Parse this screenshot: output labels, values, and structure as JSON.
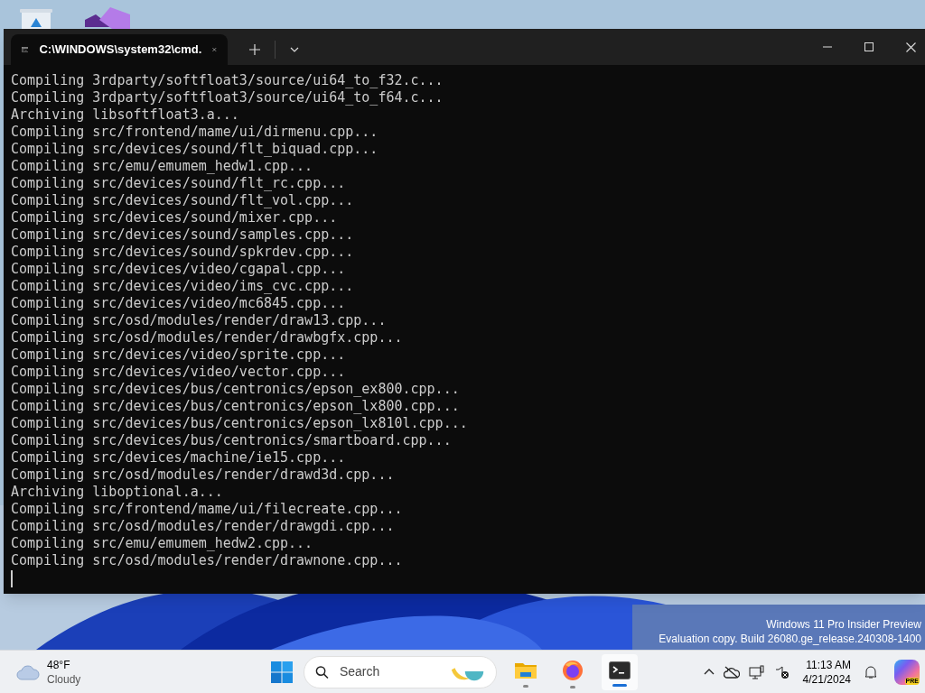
{
  "terminal": {
    "tab_title": "C:\\WINDOWS\\system32\\cmd.",
    "tab_selected": true,
    "lines": [
      "Compiling 3rdparty/softfloat3/source/ui64_to_f32.c...",
      "Compiling 3rdparty/softfloat3/source/ui64_to_f64.c...",
      "Archiving libsoftfloat3.a...",
      "Compiling src/frontend/mame/ui/dirmenu.cpp...",
      "Compiling src/devices/sound/flt_biquad.cpp...",
      "Compiling src/emu/emumem_hedw1.cpp...",
      "Compiling src/devices/sound/flt_rc.cpp...",
      "Compiling src/devices/sound/flt_vol.cpp...",
      "Compiling src/devices/sound/mixer.cpp...",
      "Compiling src/devices/sound/samples.cpp...",
      "Compiling src/devices/sound/spkrdev.cpp...",
      "Compiling src/devices/video/cgapal.cpp...",
      "Compiling src/devices/video/ims_cvc.cpp...",
      "Compiling src/devices/video/mc6845.cpp...",
      "Compiling src/osd/modules/render/draw13.cpp...",
      "Compiling src/osd/modules/render/drawbgfx.cpp...",
      "Compiling src/devices/video/sprite.cpp...",
      "Compiling src/devices/video/vector.cpp...",
      "Compiling src/devices/bus/centronics/epson_ex800.cpp...",
      "Compiling src/devices/bus/centronics/epson_lx800.cpp...",
      "Compiling src/devices/bus/centronics/epson_lx810l.cpp...",
      "Compiling src/devices/bus/centronics/smartboard.cpp...",
      "Compiling src/devices/machine/ie15.cpp...",
      "Compiling src/osd/modules/render/drawd3d.cpp...",
      "Archiving liboptional.a...",
      "Compiling src/frontend/mame/ui/filecreate.cpp...",
      "Compiling src/osd/modules/render/drawgdi.cpp...",
      "Compiling src/emu/emumem_hedw2.cpp...",
      "Compiling src/osd/modules/render/drawnone.cpp..."
    ]
  },
  "desktop_watermark": [
    "Windows 11 Pro Insider Preview",
    "Evaluation copy. Build 26080.ge_release.240308-1400"
  ],
  "taskbar": {
    "weather": {
      "temp": "48°F",
      "condition": "Cloudy"
    },
    "search": {
      "placeholder": "Search"
    },
    "apps": [
      {
        "kind": "explorer",
        "running": true,
        "active": false
      },
      {
        "kind": "firefox",
        "running": true,
        "active": false
      },
      {
        "kind": "terminal",
        "running": true,
        "active": true
      }
    ],
    "time": "11:13 AM",
    "date": "4/21/2024",
    "copilot_badge": "PRE"
  }
}
